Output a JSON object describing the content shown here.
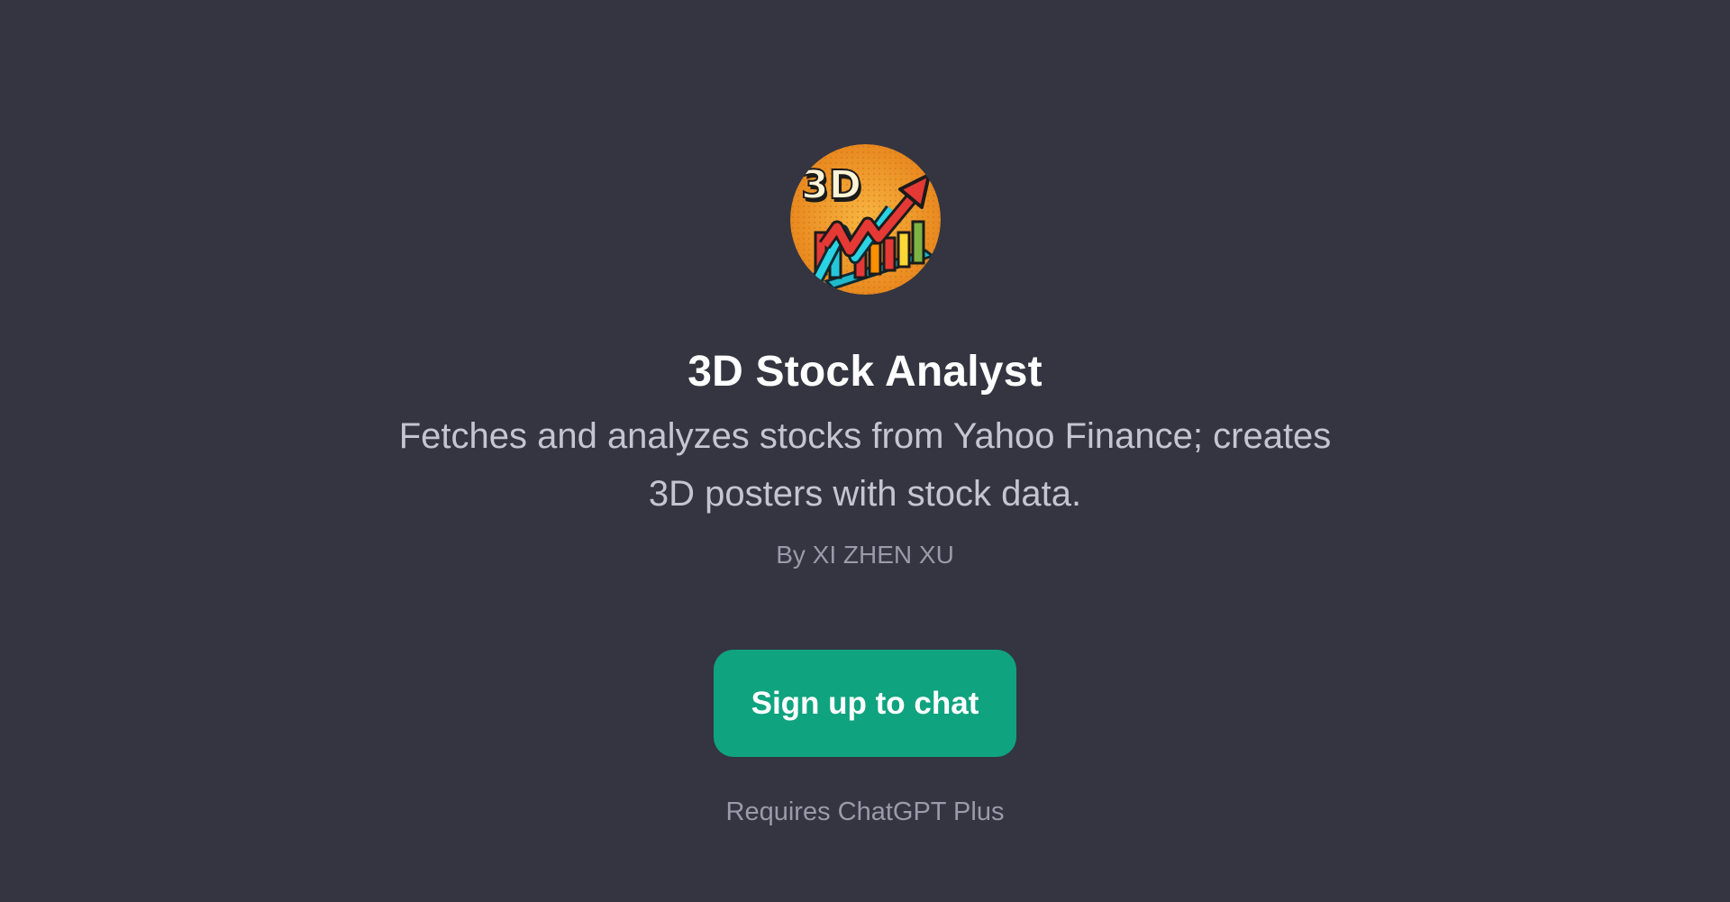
{
  "gpt": {
    "avatar_icon": "3d-stock-chart-logo-icon",
    "name": "3D Stock Analyst",
    "description": "Fetches and analyzes stocks from Yahoo Finance; creates 3D posters with stock data.",
    "author": "By XI ZHEN XU"
  },
  "actions": {
    "signup_label": "Sign up to chat",
    "requirement_note": "Requires ChatGPT Plus"
  },
  "colors": {
    "background": "#343541",
    "accent": "#10a37f",
    "title": "#ffffff",
    "body_text": "#c5c5d2",
    "muted_text": "#9a9aa8"
  }
}
